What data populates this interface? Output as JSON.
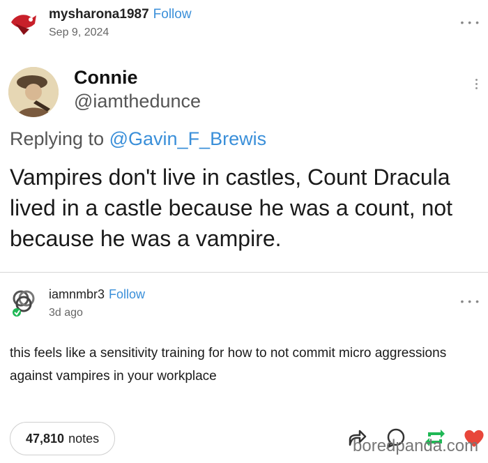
{
  "post": {
    "username": "mysharona1987",
    "follow_label": "Follow",
    "date": "Sep 9, 2024",
    "more_icon": "more-horizontal-icon"
  },
  "tweet": {
    "name": "Connie",
    "handle": "@iamthedunce",
    "replying_prefix": "Replying to",
    "replying_to": "@Gavin_F_Brewis",
    "text": "Vampires don't live in castles, Count Dracula lived in a castle because he was a count, not because he was a vampire."
  },
  "reply": {
    "username": "iamnmbr3",
    "follow_label": "Follow",
    "date": "3d ago",
    "text": "this feels like a sensitivity training for how to not commit micro aggressions against vampires in your workplace"
  },
  "footer": {
    "notes_count": "47,810",
    "notes_label": "notes",
    "watermark": "boredpanda.com",
    "icons": [
      "share-icon",
      "comment-icon",
      "reblog-icon",
      "heart-icon"
    ]
  },
  "colors": {
    "accent": "#3a8fd9",
    "reblog": "#1fb855",
    "heart": "#e8463a"
  }
}
